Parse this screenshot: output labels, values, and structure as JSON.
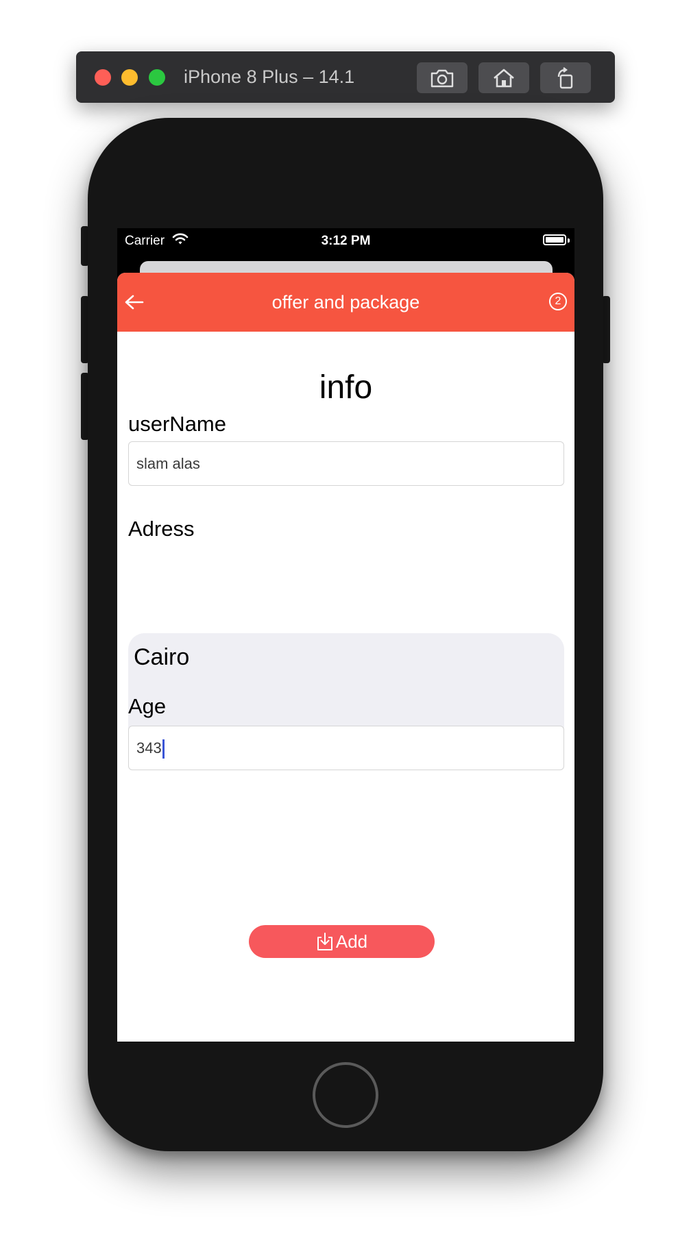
{
  "simulator": {
    "title": "iPhone 8 Plus – 14.1",
    "buttons": [
      "screenshot",
      "home",
      "rotate"
    ]
  },
  "status_bar": {
    "carrier": "Carrier",
    "time": "3:12 PM"
  },
  "app_bar": {
    "title": "offer and package",
    "badge": "2",
    "colors": {
      "background": "#f65540"
    }
  },
  "form": {
    "heading": "info",
    "username": {
      "label": "userName",
      "value": "slam alas"
    },
    "address": {
      "label": "Adress",
      "value": "Cairo"
    },
    "age": {
      "label": "Age",
      "value": "343"
    },
    "submit_label": "Add"
  },
  "colors": {
    "accent": "#f65540",
    "button": "#f7585c",
    "textarea_bg": "#efeff4"
  }
}
